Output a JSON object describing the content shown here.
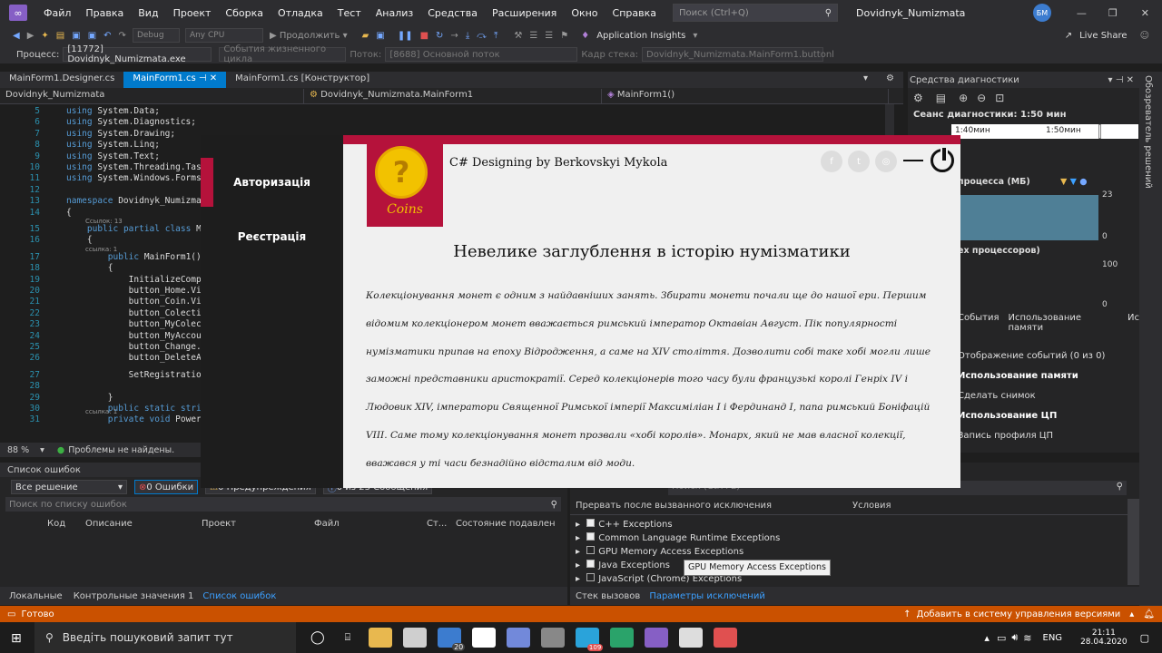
{
  "menubar": {
    "items": [
      "Файл",
      "Правка",
      "Вид",
      "Проект",
      "Сборка",
      "Отладка",
      "Тест",
      "Анализ",
      "Средства",
      "Расширения",
      "Окно",
      "Справка"
    ],
    "search_placeholder": "Поиск (Ctrl+Q)",
    "window_title": "Dovidnyk_Numizmata",
    "user_initials": "БМ"
  },
  "toolbar": {
    "config": "Debug",
    "platform": "Any CPU",
    "continue_label": "Продолжить",
    "insights_label": "Application Insights",
    "live_share_label": "Live Share"
  },
  "procbar": {
    "process_label": "Процесс:",
    "process_value": "[11772] Dovidnyk_Numizmata.exe",
    "lifecycle_label": "События жизненного цикла",
    "thread_label": "Поток:",
    "thread_value": "[8688] Основной поток",
    "stack_label": "Кадр стека:",
    "stack_value": "Dovidnyk_Numizmata.MainForm1.buttonl"
  },
  "tabs": [
    "MainForm1.Designer.cs",
    "MainForm1.cs",
    "MainForm1.cs [Конструктор]"
  ],
  "navbar": [
    "Dovidnyk_Numizmata",
    "Dovidnyk_Numizmata.MainForm1",
    "MainForm1()"
  ],
  "editor": {
    "lines": [
      {
        "n": "5",
        "t": "using System.Data;"
      },
      {
        "n": "6",
        "t": "using System.Diagnostics;"
      },
      {
        "n": "7",
        "t": "using System.Drawing;"
      },
      {
        "n": "8",
        "t": "using System.Linq;"
      },
      {
        "n": "9",
        "t": "using System.Text;"
      },
      {
        "n": "10",
        "t": "using System.Threading.Tasks;"
      },
      {
        "n": "11",
        "t": "using System.Windows.Forms;"
      },
      {
        "n": "12",
        "t": ""
      },
      {
        "n": "13",
        "t": "namespace Dovidnyk_Numizmata"
      },
      {
        "n": "14",
        "t": "{"
      },
      {
        "n": "15",
        "t": "    public partial class Main"
      },
      {
        "n": "16",
        "t": "    {"
      },
      {
        "n": "17",
        "t": "        public MainForm1()"
      },
      {
        "n": "18",
        "t": "        {"
      },
      {
        "n": "19",
        "t": "            InitializeCompone"
      },
      {
        "n": "20",
        "t": "            button_Home.Visib"
      },
      {
        "n": "21",
        "t": "            button_Coin.Visib"
      },
      {
        "n": "22",
        "t": "            button_Colectione"
      },
      {
        "n": "23",
        "t": "            button_MyColectic"
      },
      {
        "n": "24",
        "t": "            button_MyAccount."
      },
      {
        "n": "25",
        "t": "            button_Change.Vis"
      },
      {
        "n": "26",
        "t": "            button_DeleteAc.V"
      },
      {
        "n": "27",
        "t": "            SetRegistration(t"
      },
      {
        "n": "28",
        "t": ""
      },
      {
        "n": "29",
        "t": "        }"
      },
      {
        "n": "30",
        "t": "        public static string"
      },
      {
        "n": "31",
        "t": "        private void Power_Cl"
      }
    ],
    "ref_13": "Ссылок: 13",
    "ref_1": "ссылка: 1"
  },
  "statusline": {
    "zoom": "88 %",
    "issues": "Проблемы не найдены."
  },
  "errors": {
    "title": "Список ошибок",
    "scope": "Все решение",
    "errors_count": "0 Ошибки",
    "warnings_count": "0 Предупреждения",
    "messages_count": "0 из 23 Сообщения",
    "search_placeholder": "Поиск по списку ошибок",
    "columns": [
      "Код",
      "Описание",
      "Проект",
      "Файл",
      "Ст...",
      "Состояние подавлен"
    ],
    "bottom_tabs": [
      "Локальные",
      "Контрольные значения 1",
      "Список ошибок"
    ]
  },
  "diag": {
    "title": "Средства диагностики",
    "session": "Сеанс диагностики: 1:50 мин",
    "t1": "1:40мин",
    "t2": "1:50мин",
    "mem_label": "процесса (МБ)",
    "mem_max": "23",
    "mem_min": "0",
    "cpu_label": "ех процессоров)",
    "cpu_max": "100",
    "cpu_min": "0",
    "tabs": [
      "События",
      "Использование памяти",
      "Ис"
    ],
    "rows": [
      "Отображение событий (0 из 0)",
      "Использование памяти",
      "Сделать снимок",
      "Использование ЦП",
      "Запись профиля ЦП"
    ]
  },
  "side_vertical": "Обозреватель решений",
  "exceptions": {
    "search_placeholder": "Поиск (Ctrl+E)",
    "col1": "Прервать после вызванного исключения",
    "col2": "Условия",
    "items": [
      "C++ Exceptions",
      "Common Language Runtime Exceptions",
      "GPU Memory Access Exceptions",
      "Java Exceptions",
      "JavaScript (Chrome) Exceptions"
    ],
    "bottom_tabs": [
      "Стек вызовов",
      "Параметры исключений"
    ],
    "tooltip": "GPU Memory Access Exceptions"
  },
  "statusbar": {
    "ready": "Готово",
    "vcs": "Добавить в систему управления версиями"
  },
  "taskbar": {
    "search": "Введіть пошуковий запит тут",
    "badge": "20",
    "badge2": "109",
    "lang": "ENG",
    "time": "21:11",
    "date": "28.04.2020"
  },
  "app": {
    "nav": [
      "Авторизація",
      "Реєстрація"
    ],
    "logo_word": "Coins",
    "title": "C# Designing by Berkovskyi Mykola",
    "heading": "Невелике заглублення в історію нумізматики",
    "body": "Колекціонування монет є одним з найдавніших занять. Збирати монети почали ще до нашої ери. Першим відомим колекціонером монет вважається римський імператор Октавіан Август. Пік популярності нумізматики припав на епоху Відродження, а саме на XIV століття. Дозволити собі таке хобі могли лише заможні представники аристократії. Серед колекціонерів того часу були французькі королі Генріх IV і Людовик XIV, імператори Священної Римської імперії Максиміліан I і Фердинанд I, папа римський Боніфацій VIII. Саме тому колекціонування монет прозвали «хобі королів». Монарх, який не мав власної колекції, вважався у ті часи безнадійно відсталим від моди.",
    "accent": "#b5123b"
  }
}
